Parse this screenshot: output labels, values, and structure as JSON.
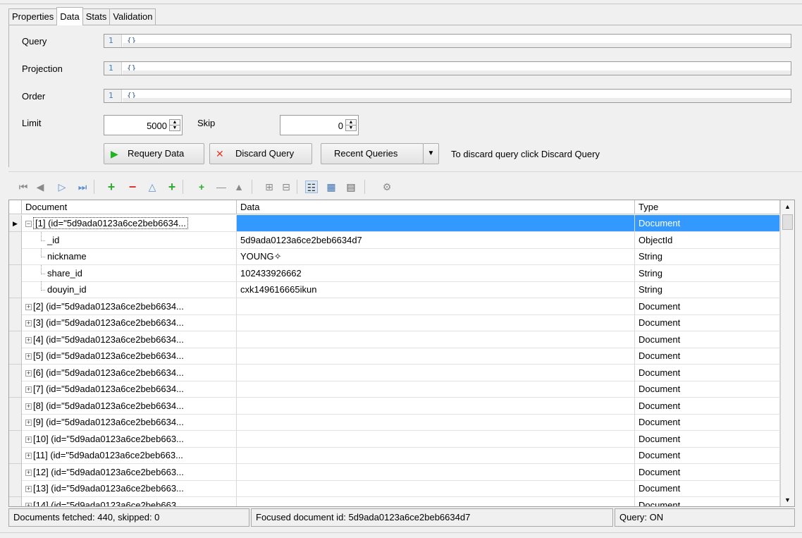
{
  "tabs": [
    "Properties",
    "Data",
    "Stats",
    "Validation"
  ],
  "query": {
    "label": "Query",
    "line": "1",
    "code": "{}"
  },
  "projection": {
    "label": "Projection",
    "line": "1",
    "code": "{}"
  },
  "order": {
    "label": "Order",
    "line": "1",
    "code": "{}"
  },
  "limit": {
    "label": "Limit",
    "value": "5000"
  },
  "skip": {
    "label": "Skip",
    "value": "0"
  },
  "buttons": {
    "requery": "Requery Data",
    "discard": "Discard Query",
    "recent": "Recent Queries"
  },
  "hint": "To discard query click Discard Query",
  "grid": {
    "columns": [
      "Document",
      "Data",
      "Type"
    ],
    "rows": [
      {
        "doc": "[1] (id=\"5d9ada0123a6ce2beb6634...",
        "data": "",
        "type": "Document",
        "level": 0,
        "expander": "−",
        "selected": true
      },
      {
        "doc": "_id",
        "data": "5d9ada0123a6ce2beb6634d7",
        "type": "ObjectId",
        "level": 1
      },
      {
        "doc": "nickname",
        "data": "YOUNG✧",
        "type": "String",
        "level": 1
      },
      {
        "doc": "share_id",
        "data": "102433926662",
        "type": "String",
        "level": 1
      },
      {
        "doc": "douyin_id",
        "data": "cxk149616665ikun",
        "type": "String",
        "level": 1
      },
      {
        "doc": "[2] (id=\"5d9ada0123a6ce2beb6634...",
        "data": "",
        "type": "Document",
        "level": 0,
        "expander": "+"
      },
      {
        "doc": "[3] (id=\"5d9ada0123a6ce2beb6634...",
        "data": "",
        "type": "Document",
        "level": 0,
        "expander": "+"
      },
      {
        "doc": "[4] (id=\"5d9ada0123a6ce2beb6634...",
        "data": "",
        "type": "Document",
        "level": 0,
        "expander": "+"
      },
      {
        "doc": "[5] (id=\"5d9ada0123a6ce2beb6634...",
        "data": "",
        "type": "Document",
        "level": 0,
        "expander": "+"
      },
      {
        "doc": "[6] (id=\"5d9ada0123a6ce2beb6634...",
        "data": "",
        "type": "Document",
        "level": 0,
        "expander": "+"
      },
      {
        "doc": "[7] (id=\"5d9ada0123a6ce2beb6634...",
        "data": "",
        "type": "Document",
        "level": 0,
        "expander": "+"
      },
      {
        "doc": "[8] (id=\"5d9ada0123a6ce2beb6634...",
        "data": "",
        "type": "Document",
        "level": 0,
        "expander": "+"
      },
      {
        "doc": "[9] (id=\"5d9ada0123a6ce2beb6634...",
        "data": "",
        "type": "Document",
        "level": 0,
        "expander": "+"
      },
      {
        "doc": "[10] (id=\"5d9ada0123a6ce2beb663...",
        "data": "",
        "type": "Document",
        "level": 0,
        "expander": "+"
      },
      {
        "doc": "[11] (id=\"5d9ada0123a6ce2beb663...",
        "data": "",
        "type": "Document",
        "level": 0,
        "expander": "+"
      },
      {
        "doc": "[12] (id=\"5d9ada0123a6ce2beb663...",
        "data": "",
        "type": "Document",
        "level": 0,
        "expander": "+"
      },
      {
        "doc": "[13] (id=\"5d9ada0123a6ce2beb663...",
        "data": "",
        "type": "Document",
        "level": 0,
        "expander": "+"
      },
      {
        "doc": "[14] (id=\"5d9ada0123a6ce2beb663...",
        "data": "",
        "type": "Document",
        "level": 0,
        "expander": "+"
      }
    ]
  },
  "status": {
    "fetched": "Documents fetched: 440, skipped: 0",
    "focused": "Focused document id: 5d9ada0123a6ce2beb6634d7",
    "query": "Query: ON"
  },
  "colors": {
    "selection": "#3399ff",
    "add": "#2eae2e",
    "remove": "#e03030",
    "play": "#1fb51f",
    "discard": "#e03a2a"
  }
}
